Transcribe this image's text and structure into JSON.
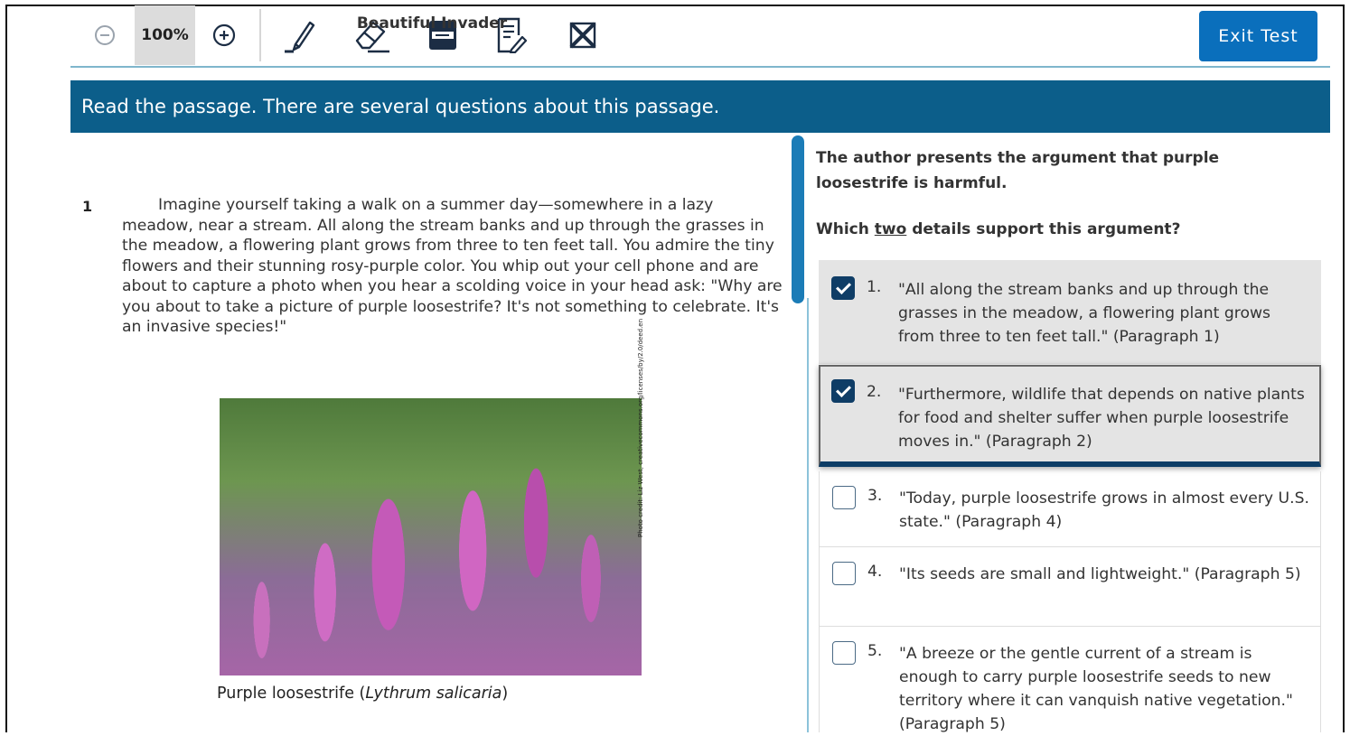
{
  "toolbar": {
    "zoom_value": "100%",
    "exit_label": "Exit Test",
    "icons": [
      "zoom-out-icon",
      "zoom-in-icon",
      "highlighter-icon",
      "eraser-icon",
      "line-reader-icon",
      "notepad-icon",
      "answer-eliminator-icon"
    ]
  },
  "banner": {
    "text": "Read the passage. There are several questions about this passage."
  },
  "passage": {
    "title": "Beautiful Invader",
    "paragraph_number": "1",
    "paragraph_text": "Imagine yourself taking a walk on a summer day—somewhere in a lazy meadow, near a stream. All along the stream banks and up through the grasses in the meadow, a flowering plant grows from three to ten feet tall. You admire the tiny flowers and their stunning rosy-purple color. You whip out your cell phone and are about to capture a photo when you hear a scolding voice in your head ask: \"Why are you about to take a picture of purple loosestrife? It's not something to celebrate. It's an invasive species!\"",
    "image_credit": "Photo credit: Liz West, creativecommons.org/licenses/by/2.0/deed.en",
    "caption_prefix": "Purple loosestrife (",
    "caption_italic": "Lythrum salicaria",
    "caption_suffix": ")"
  },
  "question": {
    "stem": "The author presents the argument that purple loosestrife is harmful.",
    "prompt_prefix": "Which ",
    "prompt_underlined": "two",
    "prompt_suffix": " details support this argument?",
    "options": [
      {
        "num": "1.",
        "text": "\"All along the stream banks and up through the grasses in the meadow, a flowering plant grows from three to ten feet tall.\" (Paragraph 1)",
        "checked": true
      },
      {
        "num": "2.",
        "text": "\"Furthermore, wildlife that depends on native plants for food and shelter suffer when purple loosestrife moves in.\" (Paragraph 2)",
        "checked": true
      },
      {
        "num": "3.",
        "text": "\"Today, purple loosestrife grows in almost every U.S. state.\" (Paragraph 4)",
        "checked": false
      },
      {
        "num": "4.",
        "text": "\"Its seeds are small and lightweight.\" (Paragraph 5)",
        "checked": false
      },
      {
        "num": "5.",
        "text": "\"A breeze or the gentle current of a stream is enough to carry purple loosestrife seeds to new territory where it can vanquish native vegetation.\" (Paragraph 5)",
        "checked": false
      }
    ]
  },
  "colors": {
    "banner": "#0c5e8a",
    "exit_button": "#0a6fbc",
    "checkbox_checked": "#0f3d66",
    "accent_line": "#7fb6cc"
  }
}
